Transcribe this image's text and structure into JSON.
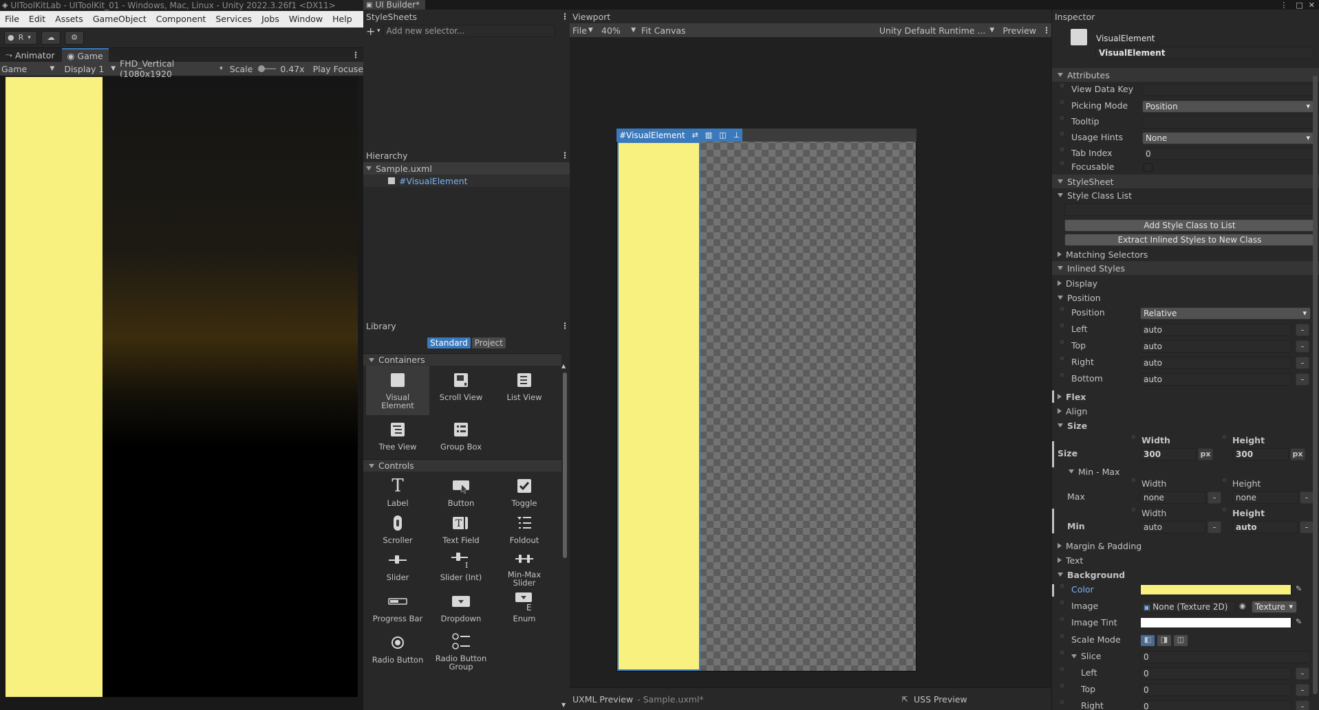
{
  "window_title": "UIToolKitLab - UIToolKit_01 - Windows, Mac, Linux - Unity 2022.3.26f1 <DX11>",
  "menu": [
    "File",
    "Edit",
    "Assets",
    "GameObject",
    "Component",
    "Services",
    "Jobs",
    "Window",
    "Help"
  ],
  "toolbar": {
    "account": "R"
  },
  "game": {
    "tabs": [
      "Animator",
      "Game"
    ],
    "mode": "Game",
    "display": "Display 1",
    "resolution": "FHD_Vertical (1080x1920",
    "scale_label": "Scale",
    "scale_value": "0.47x",
    "play_focused": "Play Focuse"
  },
  "uibuilder": {
    "tab_title": "UI Builder*"
  },
  "stylesheets": {
    "title": "StyleSheets",
    "placeholder": "Add new selector..."
  },
  "hierarchy": {
    "title": "Hierarchy",
    "file": "Sample.uxml",
    "element": "#VisualElement"
  },
  "library": {
    "title": "Library",
    "tabs": [
      "Standard",
      "Project"
    ],
    "containers_label": "Containers",
    "controls_label": "Controls",
    "containers": [
      "Visual\nElement",
      "Scroll View",
      "List View",
      "Tree View",
      "Group Box"
    ],
    "controls": [
      "Label",
      "Button",
      "Toggle",
      "Scroller",
      "Text Field",
      "Foldout",
      "Slider",
      "Slider (Int)",
      "Min-Max\nSlider",
      "Progress Bar",
      "Dropdown",
      "Enum",
      "Radio Button",
      "Radio Button\nGroup"
    ]
  },
  "viewport": {
    "title": "Viewport",
    "file_menu": "File",
    "zoom": "40%",
    "fit": "Fit Canvas",
    "theme": "Unity Default Runtime ...",
    "preview": "Preview",
    "element_label": "#VisualElement",
    "uxml_preview": "UXML Preview",
    "uxml_file": "- Sample.uxml*",
    "uss_preview": "USS Preview"
  },
  "inspector": {
    "title": "Inspector",
    "element_type": "VisualElement",
    "element_name": "VisualElement",
    "attributes": {
      "header": "Attributes",
      "view_data_key": "View Data Key",
      "picking_mode": "Picking Mode",
      "picking_mode_value": "Position",
      "tooltip": "Tooltip",
      "usage_hints": "Usage Hints",
      "usage_hints_value": "None",
      "tab_index": "Tab Index",
      "tab_index_value": "0",
      "focusable": "Focusable"
    },
    "stylesheet": {
      "header": "StyleSheet",
      "class_list": "Style Class List",
      "add_class": "Add Style Class to List",
      "extract": "Extract Inlined Styles to New Class",
      "matching": "Matching Selectors"
    },
    "inlined": {
      "header": "Inlined Styles",
      "display": "Display",
      "position_header": "Position",
      "position": "Position",
      "position_value": "Relative",
      "left": "Left",
      "left_value": "auto",
      "top": "Top",
      "top_value": "auto",
      "right": "Right",
      "right_value": "auto",
      "bottom": "Bottom",
      "bottom_value": "auto",
      "flex": "Flex",
      "align": "Align",
      "size_header": "Size",
      "width": "Width",
      "height": "Height",
      "size": "Size",
      "size_width": "300",
      "size_height": "300",
      "unit": "px",
      "min_max": "Min - Max",
      "max": "Max",
      "max_width": "none",
      "max_height": "none",
      "min": "Min",
      "min_width": "auto",
      "min_height": "auto",
      "margin_padding": "Margin & Padding",
      "text": "Text",
      "background": "Background",
      "color": "Color",
      "color_value": "#f8f07f",
      "image": "Image",
      "image_value": "None (Texture 2D)",
      "image_type": "Texture",
      "image_tint": "Image Tint",
      "scale_mode": "Scale Mode",
      "slice": "Slice",
      "slice_value": "0",
      "slice_left": "Left",
      "slice_left_value": "0",
      "slice_top": "Top",
      "slice_top_value": "0",
      "slice_right": "Right",
      "slice_right_value": "0"
    }
  }
}
